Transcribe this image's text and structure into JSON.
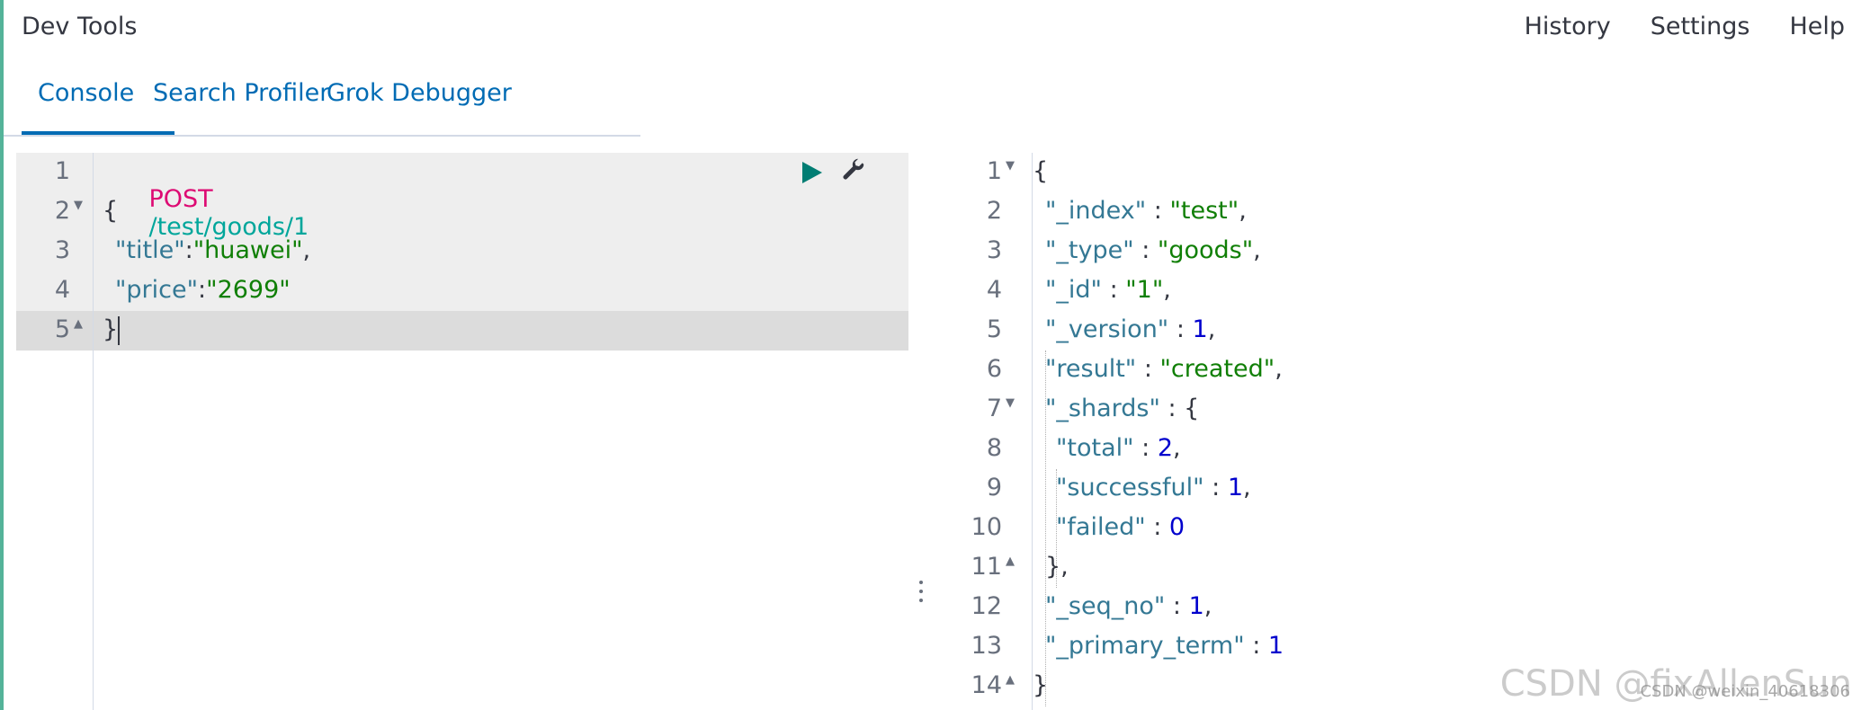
{
  "header": {
    "title": "Dev Tools",
    "links": [
      "History",
      "Settings",
      "Help"
    ]
  },
  "tabs": [
    {
      "label": "Console",
      "active": true
    },
    {
      "label": "Search Profiler",
      "active": false
    },
    {
      "label": "Grok Debugger",
      "active": false
    }
  ],
  "request": {
    "method": "POST",
    "path": "/test/goods/1",
    "lines": [
      "1",
      "2",
      "3",
      "4",
      "5"
    ],
    "body": {
      "open": "{",
      "title_key": "\"title\"",
      "title_val": "\"huawei\"",
      "price_key": "\"price\"",
      "price_val": "\"2699\"",
      "close": "}"
    }
  },
  "response": {
    "lines": [
      "1",
      "2",
      "3",
      "4",
      "5",
      "6",
      "7",
      "8",
      "9",
      "10",
      "11",
      "12",
      "13",
      "14"
    ],
    "open": "{",
    "index_key": "\"_index\"",
    "index_val": "\"test\"",
    "type_key": "\"_type\"",
    "type_val": "\"goods\"",
    "id_key": "\"_id\"",
    "id_val": "\"1\"",
    "version_key": "\"_version\"",
    "version_val": "1",
    "result_key": "\"result\"",
    "result_val": "\"created\"",
    "shards_key": "\"_shards\"",
    "total_key": "\"total\"",
    "total_val": "2",
    "successful_key": "\"successful\"",
    "successful_val": "1",
    "failed_key": "\"failed\"",
    "failed_val": "0",
    "shards_close": "},",
    "seq_key": "\"_seq_no\"",
    "seq_val": "1",
    "term_key": "\"_primary_term\"",
    "term_val": "1",
    "close": "}"
  },
  "watermark": {
    "main": "CSDN @fixAllenSun",
    "sub": "CSDN @weixin_40618306"
  },
  "colors": {
    "accent": "#006bb4",
    "keyword": "#dd0a73",
    "path": "#00a69b",
    "key": "#347894",
    "string": "#107f06",
    "number": "#0000cd"
  },
  "icons": [
    "play-icon",
    "wrench-icon",
    "fold-arrow-icon",
    "resize-handle-icon"
  ]
}
